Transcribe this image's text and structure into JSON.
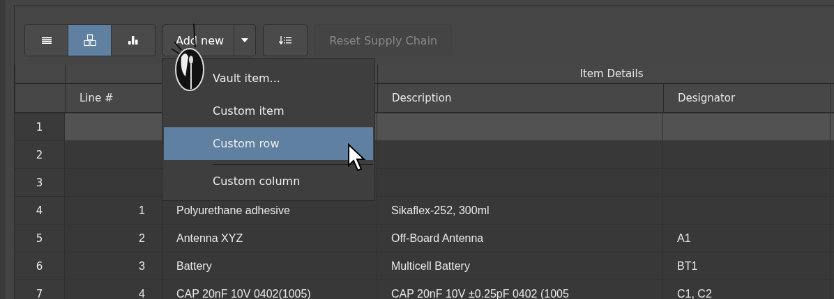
{
  "toolbar": {
    "view_buttons": [
      {
        "kind": "list",
        "selected": false
      },
      {
        "kind": "cubes",
        "selected": true
      },
      {
        "kind": "bars",
        "selected": false
      }
    ],
    "add_button": {
      "label": "Add new"
    },
    "reset_button": {
      "label": "Reset Supply Chain",
      "disabled": true
    }
  },
  "table": {
    "group_header": "Item Details",
    "columns": [
      "Line #",
      "",
      "Description",
      "Designator"
    ],
    "rows": [
      {
        "number": "1",
        "selected": true,
        "cells": [
          "",
          "",
          "",
          ""
        ]
      },
      {
        "number": "2",
        "selected": false,
        "cells": [
          "",
          "",
          "",
          ""
        ]
      },
      {
        "number": "3",
        "selected": false,
        "cells": [
          "",
          "",
          "",
          ""
        ]
      },
      {
        "number": "4",
        "selected": false,
        "cells": [
          "1",
          "Polyurethane adhesive",
          "Sikaflex-252, 300ml",
          ""
        ]
      },
      {
        "number": "5",
        "selected": false,
        "cells": [
          "2",
          "Antenna XYZ",
          "Off-Board Antenna",
          "A1"
        ]
      },
      {
        "number": "6",
        "selected": false,
        "cells": [
          "3",
          "Battery",
          "Multicell Battery",
          "BT1"
        ]
      },
      {
        "number": "7",
        "selected": false,
        "cells": [
          "4",
          "CAP 20nF 10V 0402(1005)",
          "CAP 20nF 10V ±0.25pF 0402 (1005",
          "C1, C2"
        ]
      }
    ]
  },
  "menu": {
    "items": [
      {
        "label": "Vault item...",
        "selected": false,
        "separator_before": false
      },
      {
        "label": "Custom item",
        "selected": false,
        "separator_before": false
      },
      {
        "label": "Custom row",
        "selected": true,
        "separator_before": false
      },
      {
        "label": "Custom column",
        "selected": false,
        "separator_before": true
      }
    ]
  }
}
